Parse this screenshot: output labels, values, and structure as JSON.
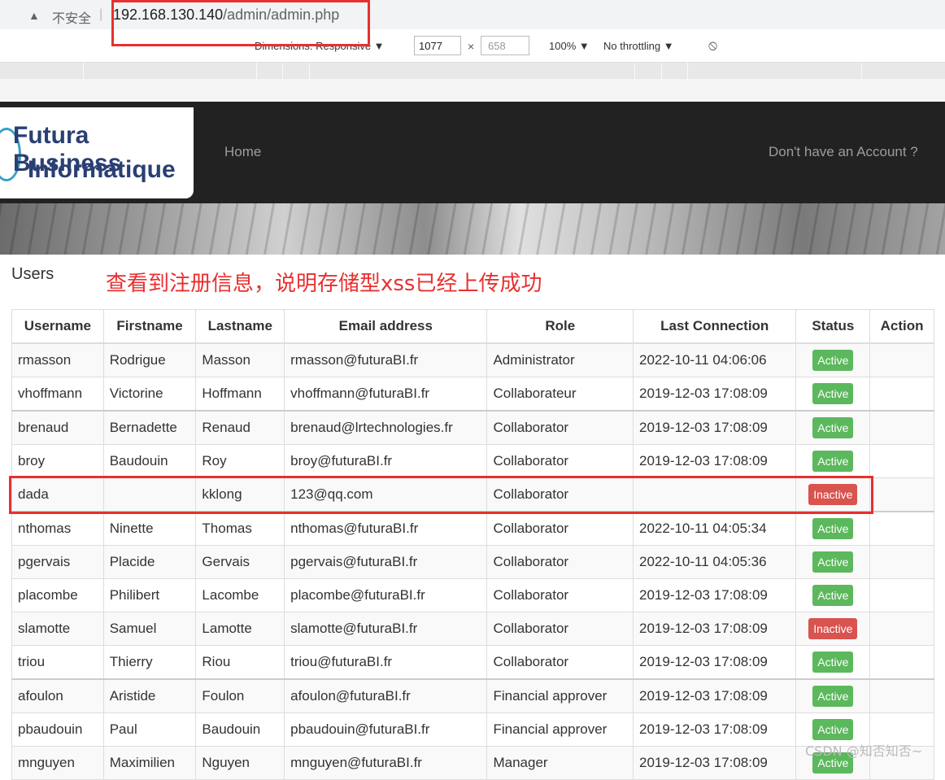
{
  "browser": {
    "security_label": "不安全",
    "url_host": "192.168.130.140",
    "url_path": "/admin/admin.php"
  },
  "devtools": {
    "dimensions_label": "Dimensions: Responsive ▼",
    "width_value": "1077",
    "times": "×",
    "height_value": "658",
    "zoom": "100% ▼",
    "throttling": "No throttling ▼"
  },
  "site": {
    "logo_line1": "Futura Business",
    "logo_line2": "Informatique",
    "nav_home": "Home",
    "nav_account": "Don't have an Account ?"
  },
  "page": {
    "title": "Users",
    "annotation": "查看到注册信息，说明存储型xss已经上传成功"
  },
  "table": {
    "headers": [
      "Username",
      "Firstname",
      "Lastname",
      "Email address",
      "Role",
      "Last Connection",
      "Status",
      "Action"
    ],
    "rows": [
      [
        "rmasson",
        "Rodrigue",
        "Masson",
        "rmasson@futuraBI.fr",
        "Administrator",
        "2022-10-11 04:06:06",
        "Active"
      ],
      [
        "vhoffmann",
        "Victorine",
        "Hoffmann",
        "vhoffmann@futuraBI.fr",
        "Collaborateur",
        "2019-12-03 17:08:09",
        "Active"
      ],
      [
        "brenaud",
        "Bernadette",
        "Renaud",
        "brenaud@lrtechnologies.fr",
        "Collaborator",
        "2019-12-03 17:08:09",
        "Active"
      ],
      [
        "broy",
        "Baudouin",
        "Roy",
        "broy@futuraBI.fr",
        "Collaborator",
        "2019-12-03 17:08:09",
        "Active"
      ],
      [
        "dada",
        "",
        "kklong",
        "123@qq.com",
        "Collaborator",
        "",
        "Inactive"
      ],
      [
        "nthomas",
        "Ninette",
        "Thomas",
        "nthomas@futuraBI.fr",
        "Collaborator",
        "2022-10-11 04:05:34",
        "Active"
      ],
      [
        "pgervais",
        "Placide",
        "Gervais",
        "pgervais@futuraBI.fr",
        "Collaborator",
        "2022-10-11 04:05:36",
        "Active"
      ],
      [
        "placombe",
        "Philibert",
        "Lacombe",
        "placombe@futuraBI.fr",
        "Collaborator",
        "2019-12-03 17:08:09",
        "Active"
      ],
      [
        "slamotte",
        "Samuel",
        "Lamotte",
        "slamotte@futuraBI.fr",
        "Collaborator",
        "2019-12-03 17:08:09",
        "Inactive"
      ],
      [
        "triou",
        "Thierry",
        "Riou",
        "triou@futuraBI.fr",
        "Collaborator",
        "2019-12-03 17:08:09",
        "Active"
      ],
      [
        "afoulon",
        "Aristide",
        "Foulon",
        "afoulon@futuraBI.fr",
        "Financial approver",
        "2019-12-03 17:08:09",
        "Active"
      ],
      [
        "pbaudouin",
        "Paul",
        "Baudouin",
        "pbaudouin@futuraBI.fr",
        "Financial approver",
        "2019-12-03 17:08:09",
        "Active"
      ],
      [
        "mnguyen",
        "Maximilien",
        "Nguyen",
        "mnguyen@futuraBI.fr",
        "Manager",
        "2019-12-03 17:08:09",
        "Active"
      ]
    ]
  },
  "watermark": "CSDN @知否知否~",
  "colors": {
    "active": "#5cb85c",
    "inactive": "#d9534f",
    "annotation": "#e8302f",
    "navbar": "#222222"
  }
}
